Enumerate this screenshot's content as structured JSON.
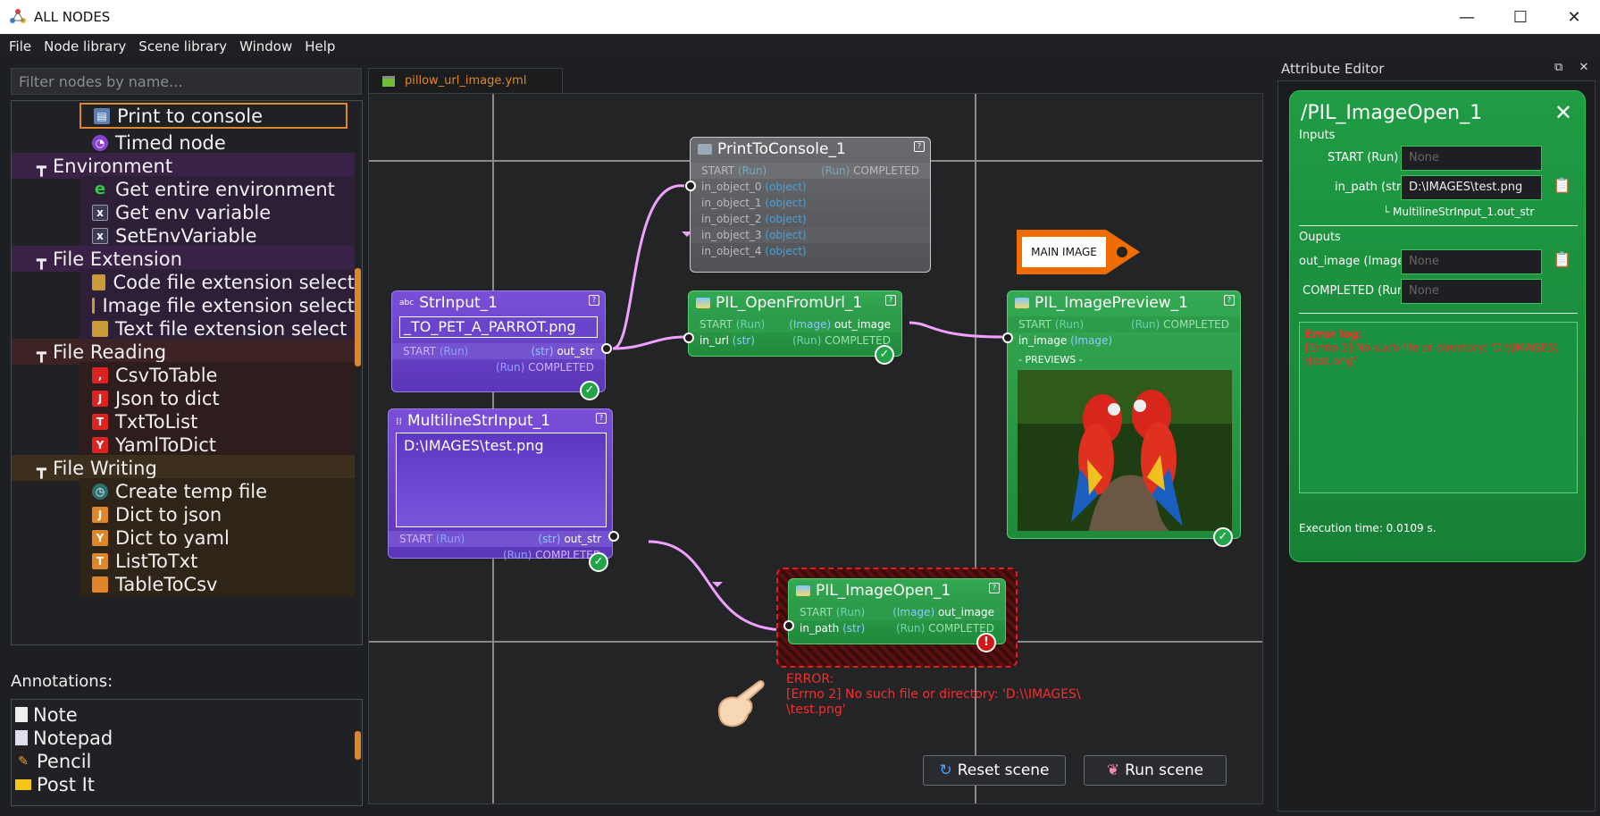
{
  "window": {
    "title": "ALL NODES",
    "minimize": "—",
    "maximize": "☐",
    "close": "✕"
  },
  "menu": [
    "File",
    "Node library",
    "Scene library",
    "Window",
    "Help"
  ],
  "filter": {
    "placeholder": "Filter nodes by name..."
  },
  "tree": {
    "items": [
      {
        "label": "Print to console",
        "kind": "leaf"
      },
      {
        "label": "Timed node",
        "kind": "leaf"
      },
      {
        "label": "Environment",
        "kind": "cat"
      },
      {
        "label": "Get entire environment",
        "kind": "leaf"
      },
      {
        "label": "Get env variable",
        "kind": "leaf"
      },
      {
        "label": "SetEnvVariable",
        "kind": "leaf"
      },
      {
        "label": "File Extension",
        "kind": "cat"
      },
      {
        "label": "Code file extension select",
        "kind": "leaf"
      },
      {
        "label": "Image file extension select",
        "kind": "leaf"
      },
      {
        "label": "Text file extension select",
        "kind": "leaf"
      },
      {
        "label": "File Reading",
        "kind": "cat"
      },
      {
        "label": "CsvToTable",
        "kind": "leaf"
      },
      {
        "label": "Json to dict",
        "kind": "leaf"
      },
      {
        "label": "TxtToList",
        "kind": "leaf"
      },
      {
        "label": "YamlToDict",
        "kind": "leaf"
      },
      {
        "label": "File Writing",
        "kind": "cat"
      },
      {
        "label": "Create temp file",
        "kind": "leaf"
      },
      {
        "label": "Dict to json",
        "kind": "leaf"
      },
      {
        "label": "Dict to yaml",
        "kind": "leaf"
      },
      {
        "label": "ListToTxt",
        "kind": "leaf"
      },
      {
        "label": "TableToCsv",
        "kind": "leaf"
      }
    ]
  },
  "annotations": {
    "title": "Annotations:",
    "items": [
      "Note",
      "Notepad",
      "Pencil",
      "Post It"
    ]
  },
  "scene": {
    "tab": "pillow_url_image.yml",
    "print_node": {
      "title": "PrintToConsole_1",
      "start": "START",
      "run": "(Run)",
      "completed": "COMPLETED",
      "inputs": [
        "in_object_0",
        "in_object_1",
        "in_object_2",
        "in_object_3",
        "in_object_4"
      ],
      "type": "(object)"
    },
    "strinput": {
      "title": "StrInput_1",
      "value": "_TO_PET_A_PARROT.png",
      "start": "START",
      "run": "(Run)",
      "out_type": "(str)",
      "out": "out_str",
      "completed": "COMPLETED"
    },
    "openurl": {
      "title": "PIL_OpenFromUrl_1",
      "start": "START",
      "run": "(Run)",
      "img_type": "(Image)",
      "out": "out_image",
      "in": "in_url",
      "in_type": "(str)",
      "completed": "COMPLETED"
    },
    "preview": {
      "title": "PIL_ImagePreview_1",
      "start": "START",
      "run": "(Run)",
      "completed": "COMPLETED",
      "in": "in_image",
      "in_type": "(Image)",
      "previews": "- PREVIEWS -"
    },
    "multiline": {
      "title": "MultilineStrInput_1",
      "value": "D:\\IMAGES\\test.png",
      "start": "START",
      "run": "(Run)",
      "out_type": "(str)",
      "out": "out_str",
      "completed": "COMPLETED"
    },
    "imageopen": {
      "title": "PIL_ImageOpen_1",
      "start": "START",
      "run": "(Run)",
      "img_type": "(Image)",
      "out": "out_image",
      "in": "in_path",
      "in_type": "(str)",
      "completed": "COMPLETED"
    },
    "tag": "MAIN IMAGE",
    "error": {
      "line1": "ERROR:",
      "line2": "[Errno 2] No such file or directory: 'D:\\\\IMAGES\\",
      "line3": "\\test.png'"
    },
    "reset": "Reset scene",
    "run": "Run scene"
  },
  "attribute_editor": {
    "title": "Attribute Editor",
    "node": "/PIL_ImageOpen_1",
    "inputs_label": "Inputs",
    "start_label": "START (Run)",
    "start_value": "None",
    "path_label": "in_path (str)",
    "path_value": "D:\\IMAGES\\test.png",
    "connection": "└  MultilineStrInput_1.out_str",
    "outputs_label": "Ouputs",
    "out_label": "out_image (Image)",
    "out_value": "None",
    "completed_label": "COMPLETED (Run)",
    "completed_value": "None",
    "err_title": "Error log:",
    "err_text": "[Errno 2] No such file or directory: 'D:\\\\IMAGES\\ \\test.png'",
    "exec_time": "Execution time: 0.0109 s."
  },
  "colors": {
    "accent": "#e0862a",
    "green": "#2ea44f",
    "purple": "#6a44cc",
    "error": "#ff2a2a"
  }
}
